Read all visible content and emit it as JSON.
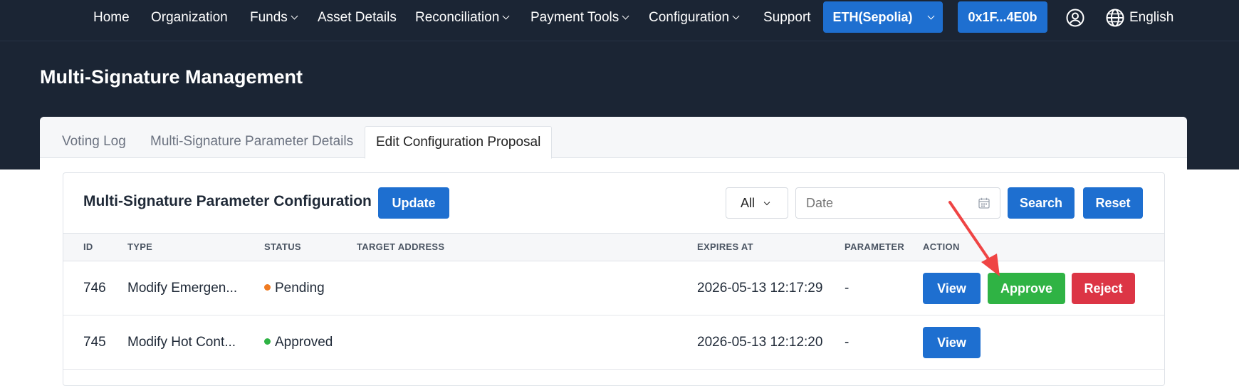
{
  "nav": {
    "items": [
      {
        "label": "Home",
        "dropdown": false
      },
      {
        "label": "Organization",
        "dropdown": false
      },
      {
        "label": "Funds",
        "dropdown": true
      },
      {
        "label": "Asset Details",
        "dropdown": false
      },
      {
        "label": "Reconciliation",
        "dropdown": true
      },
      {
        "label": "Payment Tools",
        "dropdown": true
      },
      {
        "label": "Configuration",
        "dropdown": true
      },
      {
        "label": "Support",
        "dropdown": false
      }
    ],
    "network_label": "ETH(Sepolia)",
    "wallet_label": "0x1F...4E0b",
    "language_label": "English",
    "icons": [
      "user-icon",
      "globe-icon"
    ]
  },
  "page": {
    "title": "Multi-Signature Management"
  },
  "tabs": [
    {
      "label": "Voting Log",
      "active": false
    },
    {
      "label": "Multi-Signature Parameter Details",
      "active": false
    },
    {
      "label": "Edit Configuration Proposal",
      "active": true
    }
  ],
  "panel": {
    "title": "Multi-Signature Parameter Configuration",
    "update_label": "Update",
    "filter_value": "All",
    "date_placeholder": "Date",
    "search_label": "Search",
    "reset_label": "Reset"
  },
  "table": {
    "columns": [
      "ID",
      "TYPE",
      "STATUS",
      "TARGET ADDRESS",
      "EXPIRES AT",
      "PARAMETER",
      "ACTION"
    ],
    "rows": [
      {
        "id": "746",
        "type": "Modify Emergen...",
        "status": "Pending",
        "target": "",
        "expires": "2026-05-13 12:17:29",
        "parameter": "-",
        "actions": [
          "View",
          "Approve",
          "Reject"
        ]
      },
      {
        "id": "745",
        "type": "Modify Hot Cont...",
        "status": "Approved",
        "target": "",
        "expires": "2026-05-13 12:12:20",
        "parameter": "-",
        "actions": [
          "View"
        ]
      }
    ]
  },
  "colors": {
    "header_bg": "#1b2534",
    "primary": "#1e6fd0",
    "approve": "#2fb344",
    "reject": "#dc3545",
    "pending_dot": "#f07b22",
    "approved_dot": "#2fb344",
    "annotation_arrow": "#ef4444"
  }
}
